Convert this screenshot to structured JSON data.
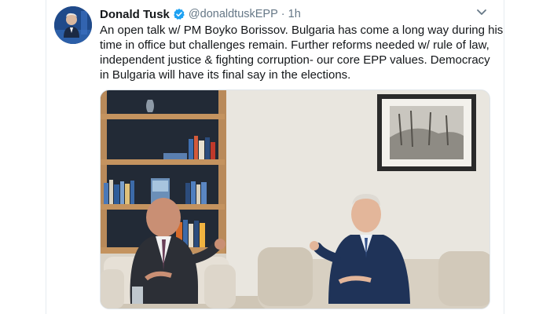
{
  "tweet": {
    "author_name": "Donald Tusk",
    "handle": "@donaldtuskEPP",
    "separator": "·",
    "time": "1h",
    "text_lines": [
      "An open talk w/ PM Boyko Borissov. Bulgaria has come a long way during his",
      "time in office but challenges remain. Further reforms needed w/ rule of law,",
      "independent justice & fighting corruption- our core EPP values. Democracy",
      "in Bulgaria will have its final say in the elections."
    ],
    "verified_icon": "verified-badge-icon",
    "menu_icon": "chevron-down-icon",
    "avatar_icon": "profile-avatar",
    "photo_description_icon": "meeting-photo"
  },
  "colors": {
    "verified": "#1da1f2",
    "text": "#14171a",
    "muted": "#657786",
    "border": "#e6ecf0"
  }
}
